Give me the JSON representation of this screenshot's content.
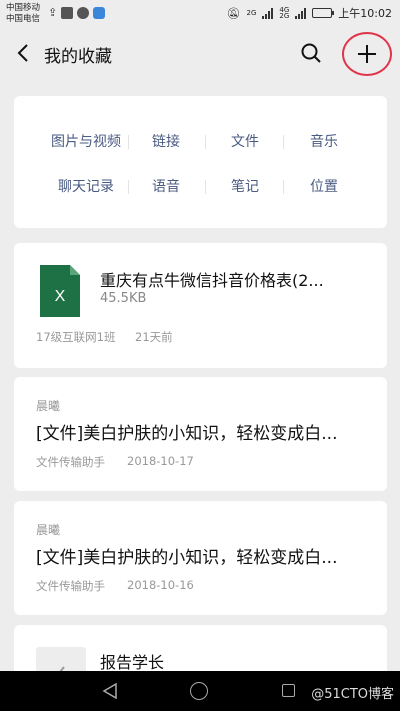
{
  "status_bar": {
    "carrier_1": "中国移动",
    "carrier_2": "中国电信",
    "signal_1": "2G",
    "signal_2": "4G",
    "signal_3": "2G",
    "battery_level": 0.8,
    "time": "上午10:02"
  },
  "nav": {
    "title": "我的收藏",
    "back_icon": "chevron-left-icon",
    "search_icon": "search-icon",
    "add_icon": "plus-icon"
  },
  "categories": [
    [
      "图片与视频",
      "链接",
      "文件",
      "音乐"
    ],
    [
      "聊天记录",
      "语音",
      "笔记",
      "位置"
    ]
  ],
  "items": [
    {
      "type": "file",
      "name": "重庆有点牛微信抖音价格表(2...",
      "size": "45.5KB",
      "source": "17级互联网1班",
      "time": "21天前",
      "icon_label": "X"
    },
    {
      "type": "note",
      "author": "晨曦",
      "title": "[文件]美白护肤的小知识，轻松变成白...",
      "source": "文件传输助手",
      "date": "2018-10-17"
    },
    {
      "type": "note",
      "author": "晨曦",
      "title": "[文件]美白护肤的小知识，轻松变成白...",
      "source": "文件传输助手",
      "date": "2018-10-16"
    },
    {
      "type": "doc",
      "title": "报告学长"
    }
  ],
  "watermark": "@51CTO博客",
  "colors": {
    "accent_link": "#4a5b82",
    "highlight_circle": "#e0344a",
    "excel_green": "#1e7145"
  }
}
